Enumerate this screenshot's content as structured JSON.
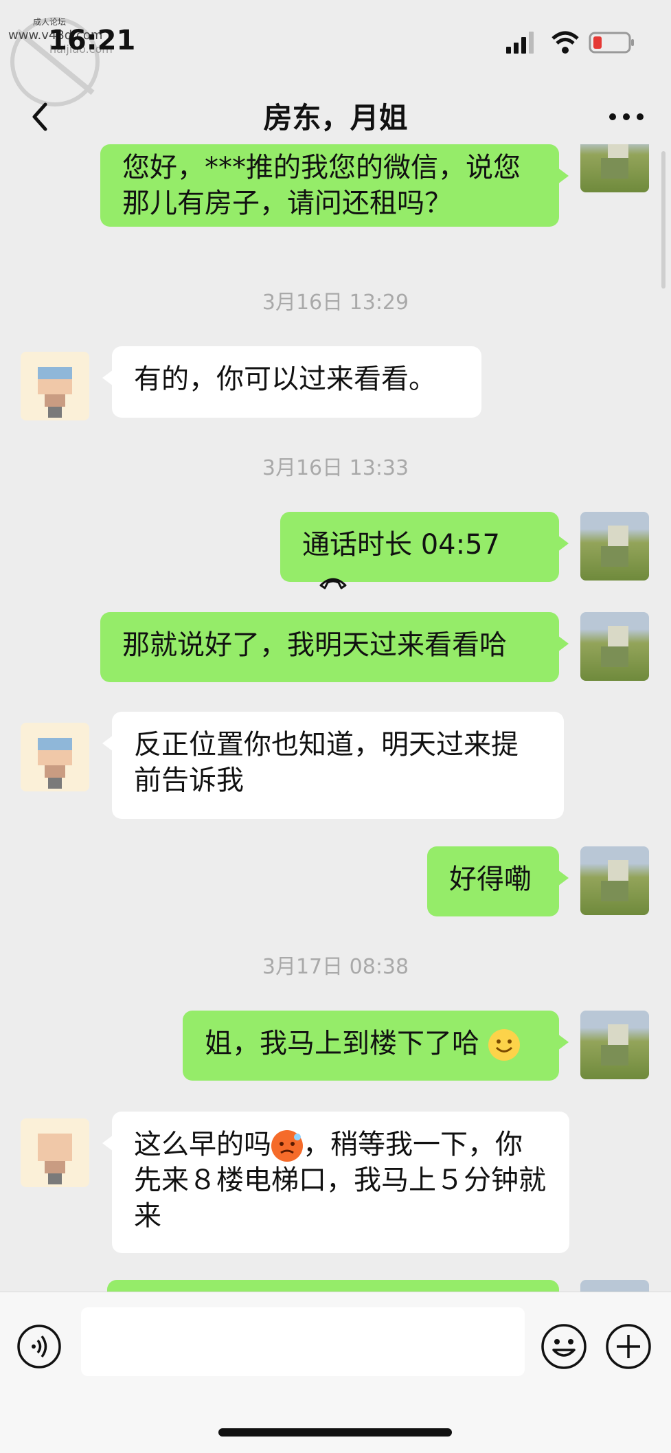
{
  "watermark": {
    "line1": "成人论坛",
    "line2": "www.v43d.com",
    "line3": "haijiao.com"
  },
  "status": {
    "time": "16:21"
  },
  "header": {
    "title": "房东，月姐"
  },
  "messages": [
    {
      "side": "right",
      "text": "您好，***推的我您的微信，说您那儿有房子，请问还租吗？"
    },
    {
      "side": "timestamp",
      "text": "3月16日 13:29"
    },
    {
      "side": "left",
      "text": "有的，你可以过来看看。"
    },
    {
      "side": "timestamp",
      "text": "3月16日 13:33"
    },
    {
      "side": "right",
      "text": "通话时长 04:57",
      "icon": "phone-hangup-icon"
    },
    {
      "side": "right",
      "text": "那就说好了，我明天过来看看哈"
    },
    {
      "side": "left",
      "text": "反正位置你也知道，明天过来提前告诉我"
    },
    {
      "side": "right",
      "text": "好得嘞"
    },
    {
      "side": "timestamp",
      "text": "3月17日 08:38"
    },
    {
      "side": "right",
      "text": "姐，我马上到楼下了哈",
      "icon": "smile-emoji-icon"
    },
    {
      "side": "left",
      "text_before": "这么早的吗",
      "text_after": "，稍等我一下，你先来８楼电梯口，我马上５分钟就来",
      "icon": "sweat-face-emoji-icon"
    }
  ],
  "input": {
    "placeholder": ""
  },
  "colors": {
    "my_bubble": "#95ec69",
    "their_bubble": "#ffffff",
    "background": "#ededed"
  }
}
